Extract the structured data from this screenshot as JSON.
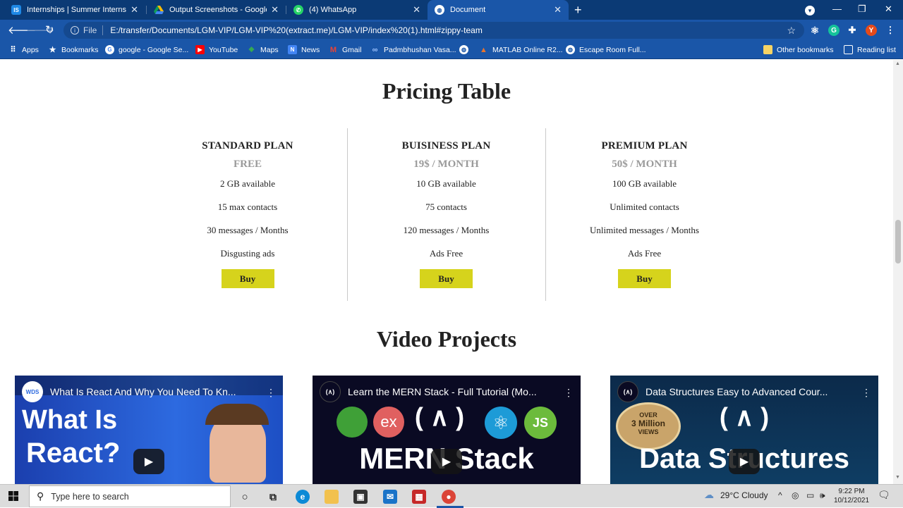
{
  "browser": {
    "tabs": [
      {
        "title": "Internships | Summer Internship",
        "favicon": "IS",
        "active": false
      },
      {
        "title": "Output Screenshots - Google Dri",
        "favicon": "drive-icon",
        "active": false
      },
      {
        "title": "(4) WhatsApp",
        "favicon": "whatsapp-icon",
        "active": false
      },
      {
        "title": "Document",
        "favicon": "globe-icon",
        "active": true
      }
    ],
    "url_scheme": "File",
    "url": "E:/transfer/Documents/LGM-VIP/LGM-VIP%20(extract.me)/LGM-VIP/index%20(1).html#zippy-team",
    "profile_initial": "Y",
    "bookmarks": [
      "Apps",
      "Bookmarks",
      "google - Google Se...",
      "YouTube",
      "Maps",
      "News",
      "Gmail",
      "Padmbhushan Vasa...",
      "",
      "MATLAB Online R2...",
      "Escape Room Full..."
    ],
    "other_bookmarks": "Other bookmarks",
    "reading_list": "Reading list"
  },
  "page": {
    "pricing_heading": "Pricing Table",
    "plans": [
      {
        "name": "STANDARD PLAN",
        "price": "FREE",
        "features": [
          "2 GB available",
          "15 max contacts",
          "30 messages / Months",
          "Disgusting ads"
        ],
        "button": "Buy"
      },
      {
        "name": "BUISINESS PLAN",
        "price": "19$ / MONTH",
        "features": [
          "10 GB available",
          "75 contacts",
          "120 messages / Months",
          "Ads Free"
        ],
        "button": "Buy"
      },
      {
        "name": "PREMIUM PLAN",
        "price": "50$ / MONTH",
        "features": [
          "100 GB available",
          "Unlimited contacts",
          "Unlimited messages / Months",
          "Ads Free"
        ],
        "button": "Buy"
      }
    ],
    "video_heading": "Video Projects",
    "videos": [
      {
        "title": "What Is React And Why You Need To Kn...",
        "channel_badge": "WDS",
        "thumb_text": [
          "What Is",
          "React?"
        ]
      },
      {
        "title": "Learn the MERN Stack - Full Tutorial (Mo...",
        "channel_badge": "(∧)",
        "thumb_text": [
          "( ∧ )",
          "MERN Stack"
        ],
        "tech_logos": [
          "ex",
          "JS"
        ]
      },
      {
        "title": "Data Structures Easy to Advanced Cour...",
        "channel_badge": "(∧)",
        "thumb_text": [
          "( ∧ )",
          "Data Structures"
        ],
        "badge": [
          "OVER",
          "3 Million",
          "VIEWS"
        ]
      }
    ]
  },
  "taskbar": {
    "search_placeholder": "Type here to search",
    "weather": "29°C  Cloudy",
    "time": "9:22 PM",
    "date": "10/12/2021"
  },
  "colors": {
    "tabstrip": "#0b3a75",
    "toolbar": "#1a56a8",
    "buy_button": "#d6d31c"
  }
}
